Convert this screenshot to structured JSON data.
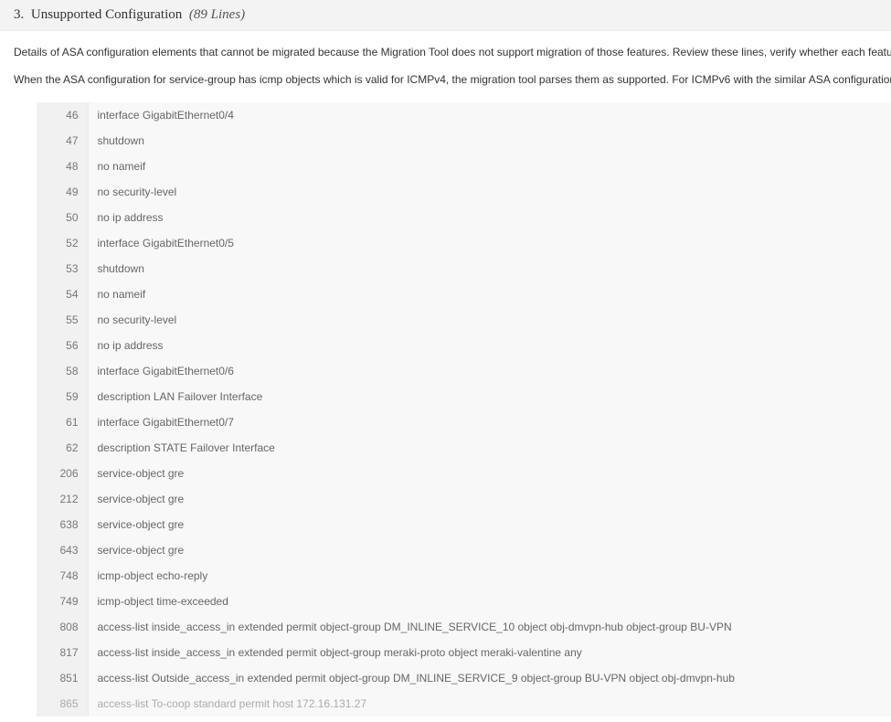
{
  "header": {
    "section_number": "3.",
    "section_title": "Unsupported Configuration",
    "line_count_label": "(89 Lines)"
  },
  "intro1": "Details of ASA configuration elements that cannot be migrated because the Migration Tool does not support migration of those features. Review these lines, verify whether each feature is supported in Firepower Manag",
  "intro2": "When the ASA configuration for service-group has icmp objects which is valid for ICMPv4, the migration tool parses them as supported. For ICMPv6 with the similar ASA configuration, it is invalid and is reported as",
  "rows": [
    {
      "line": "46",
      "text": "interface GigabitEthernet0/4"
    },
    {
      "line": "47",
      "text": "shutdown"
    },
    {
      "line": "48",
      "text": "no nameif"
    },
    {
      "line": "49",
      "text": "no security-level"
    },
    {
      "line": "50",
      "text": "no ip address"
    },
    {
      "line": "52",
      "text": "interface GigabitEthernet0/5"
    },
    {
      "line": "53",
      "text": "shutdown"
    },
    {
      "line": "54",
      "text": "no nameif"
    },
    {
      "line": "55",
      "text": "no security-level"
    },
    {
      "line": "56",
      "text": "no ip address"
    },
    {
      "line": "58",
      "text": "interface GigabitEthernet0/6"
    },
    {
      "line": "59",
      "text": "description LAN Failover Interface"
    },
    {
      "line": "61",
      "text": "interface GigabitEthernet0/7"
    },
    {
      "line": "62",
      "text": "description STATE Failover Interface"
    },
    {
      "line": "206",
      "text": "service-object gre"
    },
    {
      "line": "212",
      "text": "service-object gre"
    },
    {
      "line": "638",
      "text": "service-object gre"
    },
    {
      "line": "643",
      "text": "service-object gre"
    },
    {
      "line": "748",
      "text": "icmp-object echo-reply"
    },
    {
      "line": "749",
      "text": "icmp-object time-exceeded"
    },
    {
      "line": "808",
      "text": "access-list inside_access_in extended permit object-group DM_INLINE_SERVICE_10 object obj-dmvpn-hub object-group BU-VPN"
    },
    {
      "line": "817",
      "text": "access-list inside_access_in extended permit object-group meraki-proto object meraki-valentine any"
    },
    {
      "line": "851",
      "text": "access-list Outside_access_in extended permit object-group DM_INLINE_SERVICE_9 object-group BU-VPN object obj-dmvpn-hub"
    },
    {
      "line": "865",
      "text": "access-list To-coop standard permit host 172.16.131.27"
    }
  ]
}
